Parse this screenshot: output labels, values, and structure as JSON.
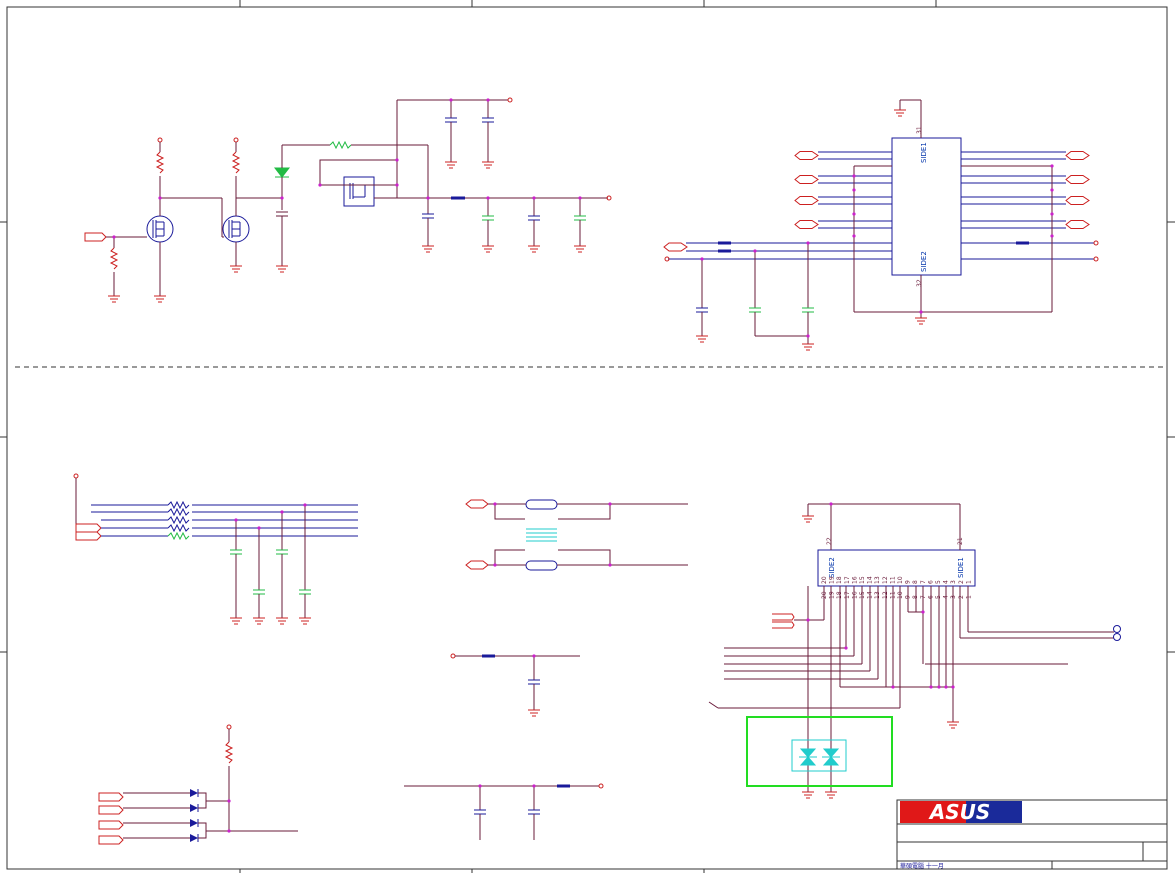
{
  "connectors": {
    "top": {
      "side1_label": "SIDE1",
      "side2_label": "SIDE2",
      "pin_top": "31",
      "pin_bottom": "32"
    },
    "bottom": {
      "side1_label": "SIDE1",
      "side2_label": "SIDE2",
      "pin_side2": "22",
      "pin_side1": "21",
      "pins_left": [
        "20",
        "19",
        "18",
        "17",
        "16",
        "15",
        "14",
        "13",
        "12",
        "11",
        "10",
        "9",
        "8",
        "7",
        "6",
        "5",
        "4",
        "3",
        "2",
        "1"
      ]
    }
  },
  "title_block": {
    "logo_text": "ASUS",
    "footer_text": "華碩電腦 十一月"
  },
  "colors": {
    "wire": "#6a1b3a",
    "power": "#cc2020",
    "component_blue": "#1a1a9a",
    "green_part": "#22bb44",
    "cyan_part": "#22cccc",
    "junction": "#cc22cc",
    "highlight_box": "#22dd22"
  }
}
